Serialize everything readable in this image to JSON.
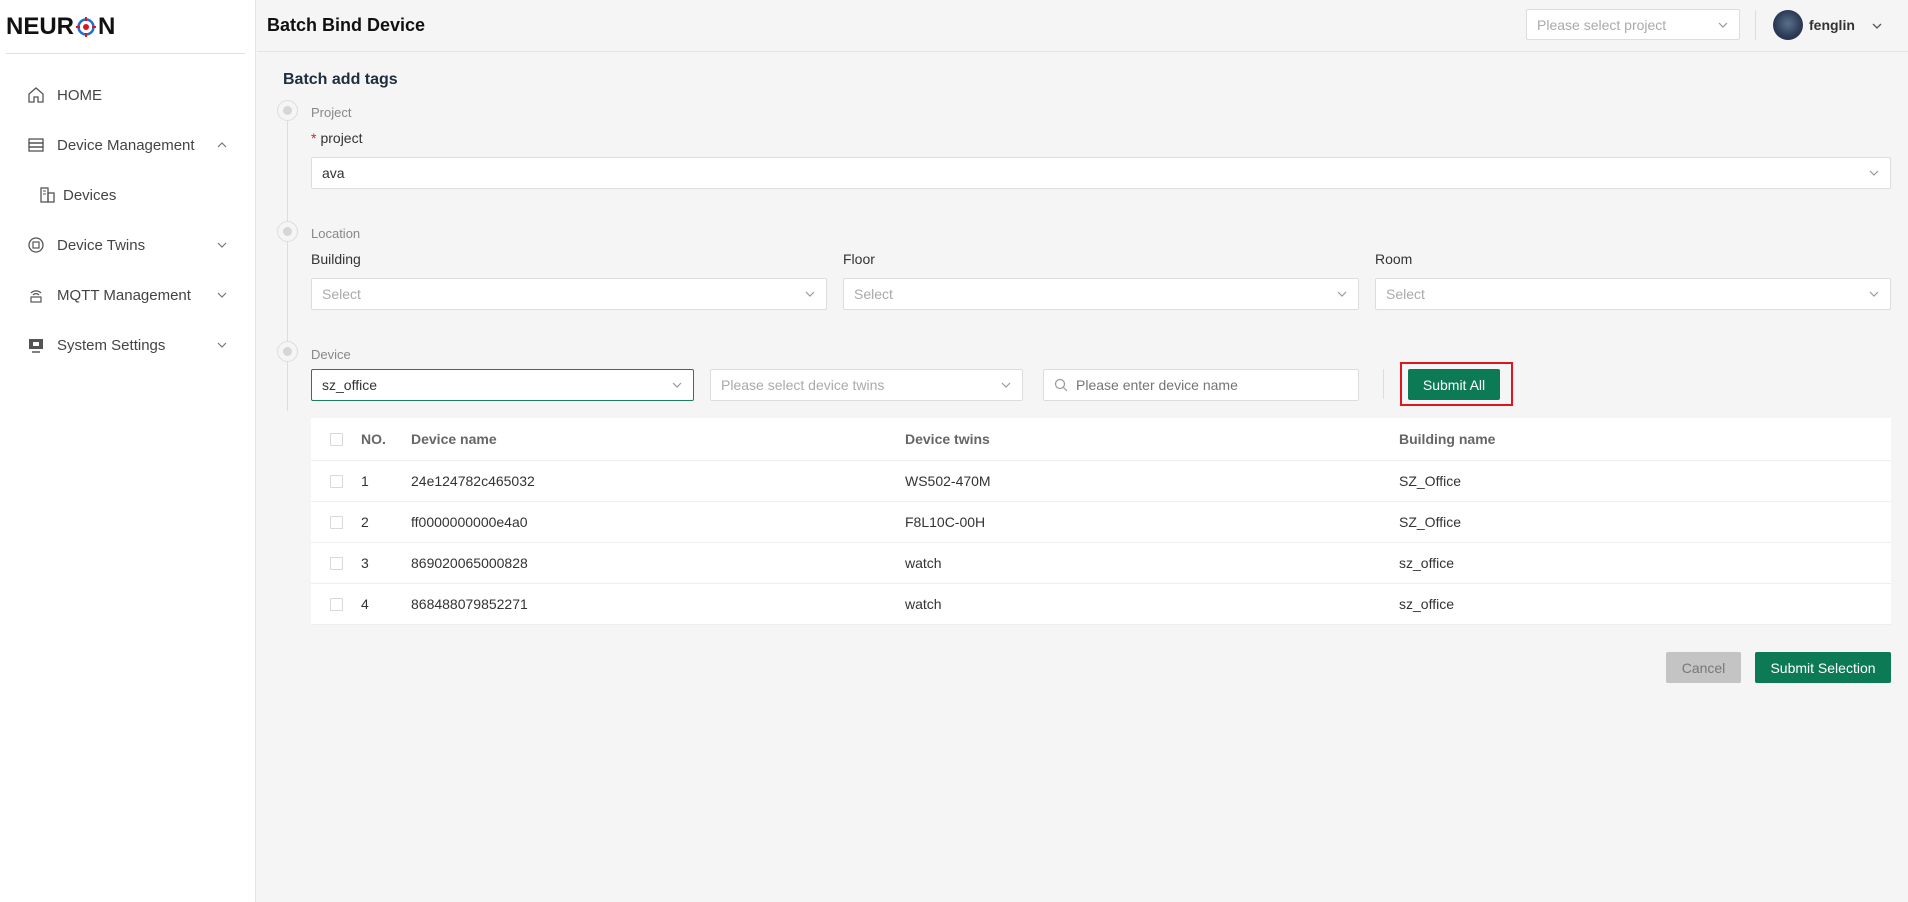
{
  "sidebar": {
    "logo": {
      "pre": "NEUR",
      "post": "N"
    },
    "items": [
      {
        "label": "HOME",
        "icon": "home-icon"
      },
      {
        "label": "Device Management",
        "icon": "server-icon",
        "expanded": true
      },
      {
        "label": "Devices",
        "icon": "devices-icon"
      },
      {
        "label": "Device Twins",
        "icon": "twins-icon"
      },
      {
        "label": "MQTT Management",
        "icon": "mqtt-icon"
      },
      {
        "label": "System Settings",
        "icon": "monitor-icon"
      }
    ]
  },
  "header": {
    "title": "Batch Bind Device",
    "project_placeholder": "Please select project",
    "username": "fenglin"
  },
  "main": {
    "section_title": "Batch add tags",
    "steps": {
      "project": {
        "step_label": "Project",
        "field_label": "project",
        "value": "ava"
      },
      "location": {
        "step_label": "Location",
        "building_label": "Building",
        "floor_label": "Floor",
        "room_label": "Room",
        "building_placeholder": "Select",
        "floor_placeholder": "Select",
        "room_placeholder": "Select"
      },
      "device": {
        "step_label": "Device",
        "building_value": "sz_office",
        "twins_placeholder": "Please select device twins",
        "name_placeholder": "Please enter device name",
        "submit_all": "Submit All"
      }
    },
    "table": {
      "columns": [
        "NO.",
        "Device name",
        "Device twins",
        "Building name"
      ],
      "rows": [
        {
          "no": "1",
          "name": "24e124782c465032",
          "twins": "WS502-470M",
          "building": "SZ_Office"
        },
        {
          "no": "2",
          "name": "ff0000000000e4a0",
          "twins": "F8L10C-00H",
          "building": "SZ_Office"
        },
        {
          "no": "3",
          "name": "869020065000828",
          "twins": "watch",
          "building": "sz_office"
        },
        {
          "no": "4",
          "name": "868488079852271",
          "twins": "watch",
          "building": "sz_office"
        }
      ]
    },
    "actions": {
      "cancel": "Cancel",
      "submit_selection": "Submit Selection"
    }
  },
  "colors": {
    "primary": "#0b7a55",
    "highlight": "#e0141e",
    "logo_accent": "#e0141e"
  }
}
